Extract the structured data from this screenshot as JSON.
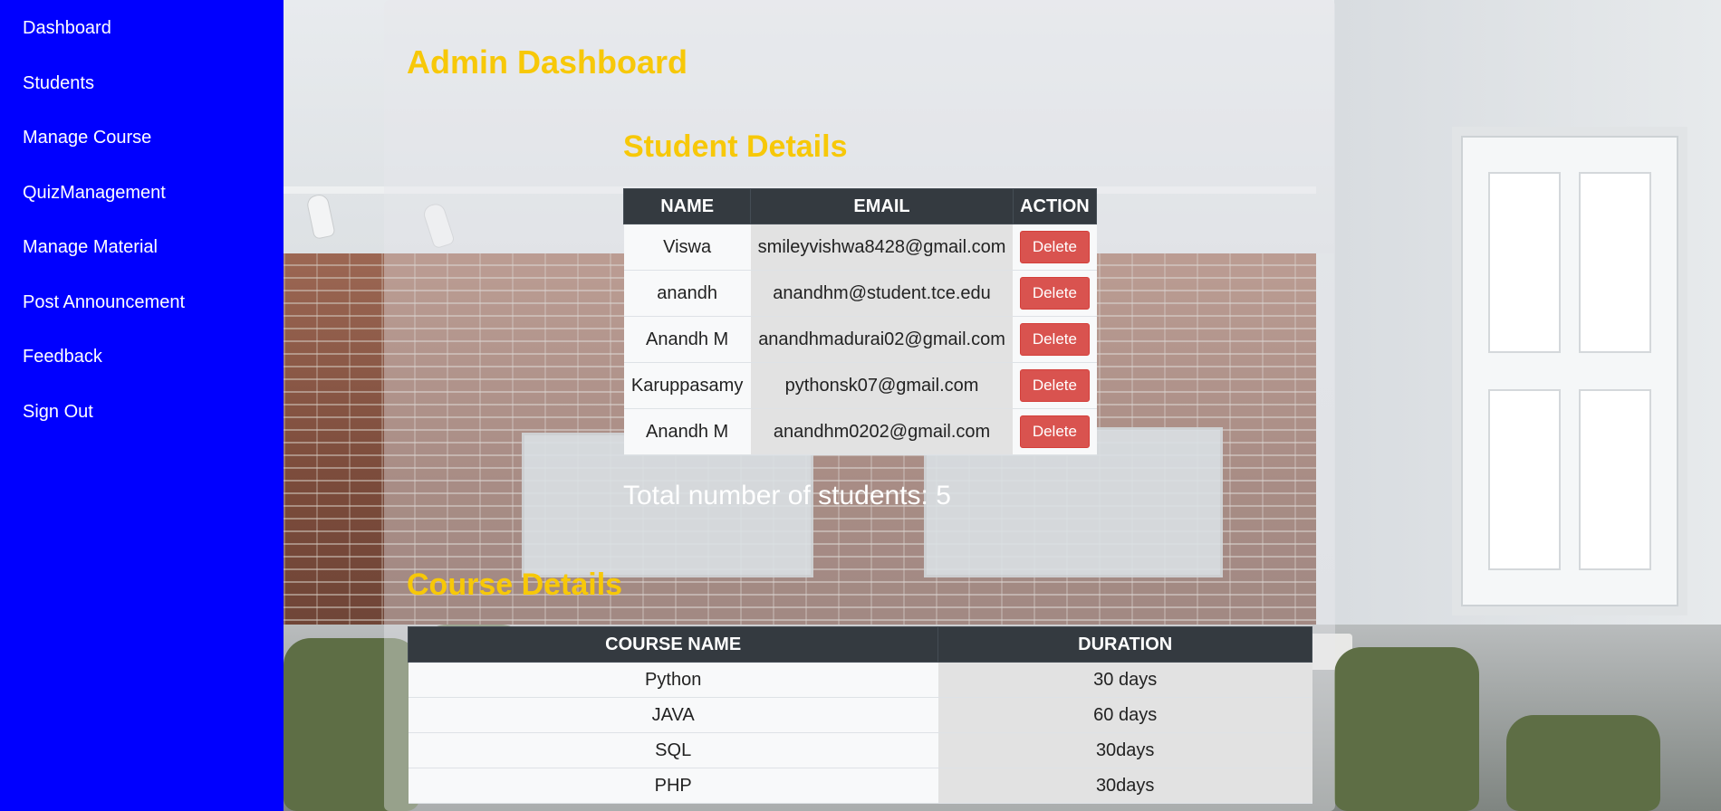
{
  "sidebar": {
    "items": [
      {
        "label": "Dashboard"
      },
      {
        "label": "Students"
      },
      {
        "label": "Manage Course"
      },
      {
        "label": "QuizManagement"
      },
      {
        "label": "Manage Material"
      },
      {
        "label": "Post Announcement"
      },
      {
        "label": "Feedback"
      },
      {
        "label": "Sign Out"
      }
    ]
  },
  "page": {
    "title": "Admin Dashboard"
  },
  "students": {
    "heading": "Student Details",
    "columns": [
      "NAME",
      "EMAIL",
      "ACTION"
    ],
    "rows": [
      {
        "name": "Viswa",
        "email": "smileyvishwa8428@gmail.com",
        "action": "Delete"
      },
      {
        "name": "anandh",
        "email": "anandhm@student.tce.edu",
        "action": "Delete"
      },
      {
        "name": "Anandh M",
        "email": "anandhmadurai02@gmail.com",
        "action": "Delete"
      },
      {
        "name": "Karuppasamy",
        "email": "pythonsk07@gmail.com",
        "action": "Delete"
      },
      {
        "name": "Anandh M",
        "email": "anandhm0202@gmail.com",
        "action": "Delete"
      }
    ],
    "total_text": "Total number of students: 5"
  },
  "courses": {
    "heading": "Course Details",
    "columns": [
      "COURSE NAME",
      "DURATION"
    ],
    "rows": [
      {
        "name": "Python",
        "duration": "30 days"
      },
      {
        "name": "JAVA",
        "duration": "60 days"
      },
      {
        "name": "SQL",
        "duration": "30days"
      },
      {
        "name": "PHP",
        "duration": "30days"
      }
    ]
  },
  "colors": {
    "sidebar_bg": "#0000ff",
    "heading": "#f7c808",
    "table_header": "#343a40",
    "delete_button": "#d9534f"
  }
}
